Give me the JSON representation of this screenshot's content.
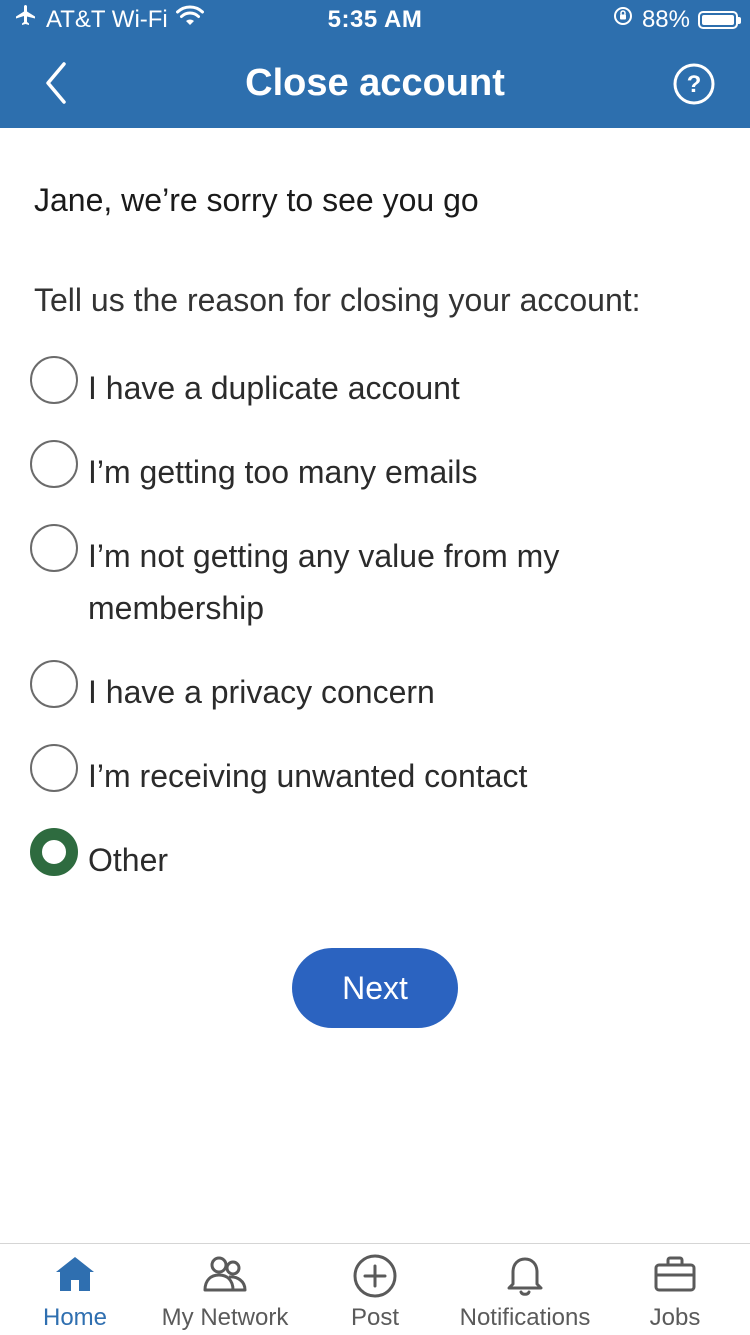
{
  "status_bar": {
    "carrier": "AT&T Wi-Fi",
    "time": "5:35 AM",
    "battery_percent": "88%",
    "battery_level": 0.88
  },
  "header": {
    "title": "Close account",
    "back_icon": "chevron-left-icon",
    "help_icon": "help-circle-icon"
  },
  "main": {
    "farewell": "Jane, we’re sorry to see you go",
    "prompt": "Tell us the reason for closing your account:",
    "options": [
      {
        "label": "I have a duplicate account",
        "selected": false
      },
      {
        "label": "I’m getting too many emails",
        "selected": false
      },
      {
        "label": "I’m not getting any value from my membership",
        "selected": false
      },
      {
        "label": "I have a privacy concern",
        "selected": false
      },
      {
        "label": "I’m receiving unwanted contact",
        "selected": false
      },
      {
        "label": "Other",
        "selected": true
      }
    ],
    "next_label": "Next"
  },
  "tabbar": {
    "items": [
      {
        "label": "Home",
        "icon": "home-icon",
        "active": true
      },
      {
        "label": "My Network",
        "icon": "network-icon",
        "active": false
      },
      {
        "label": "Post",
        "icon": "plus-circle-icon",
        "active": false
      },
      {
        "label": "Notifications",
        "icon": "bell-icon",
        "active": false
      },
      {
        "label": "Jobs",
        "icon": "briefcase-icon",
        "active": false
      }
    ]
  },
  "colors": {
    "header_bg": "#2d6fae",
    "selected_radio": "#2e6b3f",
    "primary_button": "#2b63c0",
    "active_tab": "#2f6fb0"
  }
}
